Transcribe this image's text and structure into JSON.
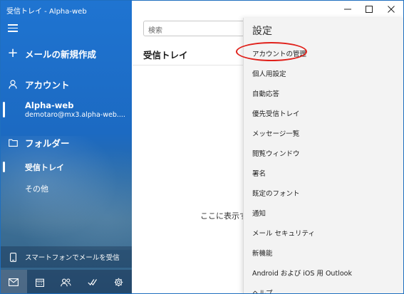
{
  "window": {
    "title": "受信トレイ - Alpha-web"
  },
  "sidebar": {
    "new_mail": "メールの新規作成",
    "accounts_heading": "アカウント",
    "account": {
      "name": "Alpha-web",
      "email": "demotaro@mx3.alpha-web...."
    },
    "folders_heading": "フォルダー",
    "folders": [
      {
        "label": "受信トレイ"
      },
      {
        "label": "その他"
      }
    ],
    "phone_prompt": "スマートフォンでメールを受信",
    "bottom_nav": [
      "mail-icon",
      "calendar-icon",
      "people-icon",
      "todo-icon",
      "settings-icon"
    ]
  },
  "mail_list": {
    "search_placeholder": "検索",
    "title": "受信トレイ",
    "empty_text": "ここに表示す"
  },
  "settings": {
    "title": "設定",
    "items": [
      {
        "label": "アカウントの管理"
      },
      {
        "label": "個人用設定"
      },
      {
        "label": "自動応答"
      },
      {
        "label": "優先受信トレイ"
      },
      {
        "label": "メッセージ一覧"
      },
      {
        "label": "閲覧ウィンドウ"
      },
      {
        "label": "署名"
      },
      {
        "label": "既定のフォント"
      },
      {
        "label": "通知"
      },
      {
        "label": "メール セキュリティ"
      },
      {
        "label": "新機能"
      },
      {
        "label": "Android および iOS 用 Outlook"
      },
      {
        "label": "ヘルプ"
      }
    ]
  },
  "colors": {
    "accent": "#1f74d1",
    "highlight_oval": "#e0201a"
  }
}
